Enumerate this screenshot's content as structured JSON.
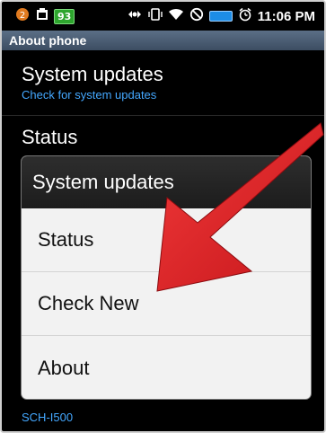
{
  "status_bar": {
    "left_icons": [
      "notification-badge-icon",
      "sim-icon",
      "battery-level-badge"
    ],
    "battery_level_badge": "93",
    "right_icons": [
      "sync-icon",
      "vibrate-icon",
      "wifi-icon",
      "no-entry-icon",
      "battery-icon",
      "alarm-icon"
    ],
    "time": "11:06 PM"
  },
  "title_bar": {
    "title": "About phone"
  },
  "settings": {
    "items": [
      {
        "title": "System updates",
        "subtitle": "Check for system updates"
      },
      {
        "title": "Status"
      }
    ],
    "model_number": "SCH-I500"
  },
  "dialog": {
    "title": "System updates",
    "options": [
      "Status",
      "Check New",
      "About"
    ]
  },
  "colors": {
    "title_bar": "#4b5f76",
    "subtitle": "#44a8ff",
    "arrow": "#e31e24",
    "dialog_bg": "#f2f2f2",
    "dialog_header": "#222222"
  }
}
